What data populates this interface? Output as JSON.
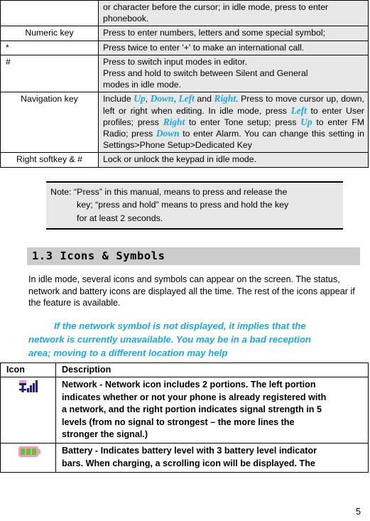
{
  "key_table": {
    "rows": [
      {
        "label": "",
        "label_align": "center",
        "lines": [
          "or character before the cursor; in idle mode, press to enter",
          "phonebook."
        ]
      },
      {
        "label": "Numeric key",
        "label_align": "center",
        "lines": [
          "Press to enter numbers, letters and some special symbol;"
        ]
      },
      {
        "label": "*",
        "label_align": "left",
        "lines": [
          "Press twice to enter '+' to make an international call."
        ]
      },
      {
        "label": "#",
        "label_align": "left",
        "lines": [
          "Press to switch input modes in editor.",
          "Press and hold to switch between Silent and General",
          "modes in idle mode."
        ]
      },
      {
        "label": "Navigation key",
        "label_align": "center",
        "nav_text": {
          "segments": [
            {
              "t": "Include ",
              "color": "plain"
            },
            {
              "t": "Up",
              "color": "blue"
            },
            {
              "t": ", ",
              "color": "plain"
            },
            {
              "t": "Down",
              "color": "blue"
            },
            {
              "t": ", ",
              "color": "plain"
            },
            {
              "t": "Left",
              "color": "blue"
            },
            {
              "t": " and ",
              "color": "plain"
            },
            {
              "t": "Right",
              "color": "blue"
            },
            {
              "t": ". Press to move cursor up, down, left or right when editing. In idle mode, press ",
              "color": "plain"
            },
            {
              "t": "Left",
              "color": "blue"
            },
            {
              "t": " to enter User profiles; press ",
              "color": "plain"
            },
            {
              "t": "Right",
              "color": "blue"
            },
            {
              "t": " to enter Tone setup; press ",
              "color": "plain"
            },
            {
              "t": "Up",
              "color": "blue"
            },
            {
              "t": " to enter FM Radio; press ",
              "color": "plain"
            },
            {
              "t": "Down",
              "color": "blue"
            },
            {
              "t": " to enter Alarm. You can change this setting in Settings>Phone Setup>Dedicated Key",
              "color": "plain"
            }
          ]
        }
      },
      {
        "label": "Right softkey & #",
        "label_align": "center",
        "lines": [
          "Lock or unlock the keypad in idle mode."
        ]
      }
    ]
  },
  "note": {
    "line1": "Note: “Press” in this manual, means to press and release the",
    "line2": "key; “press and hold” means to press and hold the key",
    "line3": "for at least 2 seconds."
  },
  "section": {
    "heading": "1.3  Icons & Symbols",
    "intro": "In idle mode, several icons and symbols can appear on the screen. The status, network and battery icons are displayed all the time. The rest of the icons appear if the feature is available.",
    "notice_line1": "If the network symbol is not displayed, it implies that the",
    "notice_line2": "network is currently unavailable. You may be in a bad reception",
    "notice_line3": "area; moving to a different location may help"
  },
  "icon_table": {
    "headers": {
      "icon": "Icon",
      "description": "Description"
    },
    "rows": [
      {
        "icon_name": "network-signal-icon",
        "desc_lines": [
          "Network - Network icon includes 2 portions. The left portion",
          "indicates whether or not your phone is already registered with",
          "a network, and the right portion indicates signal strength in 5",
          "levels (from no signal to strongest – the more lines the",
          "stronger the signal.)"
        ]
      },
      {
        "icon_name": "battery-level-icon",
        "desc_lines": [
          "Battery - Indicates battery level with 3 battery level indicator",
          "bars. When charging, a scrolling icon will be displayed. The"
        ]
      }
    ]
  },
  "footer": {
    "page_number": "5"
  },
  "colors": {
    "accent_blue": "#1ba7e8",
    "table_cell_gray": "#e8e8e8",
    "heading_band_gray": "#cccccc",
    "network_icon_navy": "#1d1d7a",
    "network_icon_pink": "#f49ac1",
    "battery_green": "#5ec72b"
  }
}
